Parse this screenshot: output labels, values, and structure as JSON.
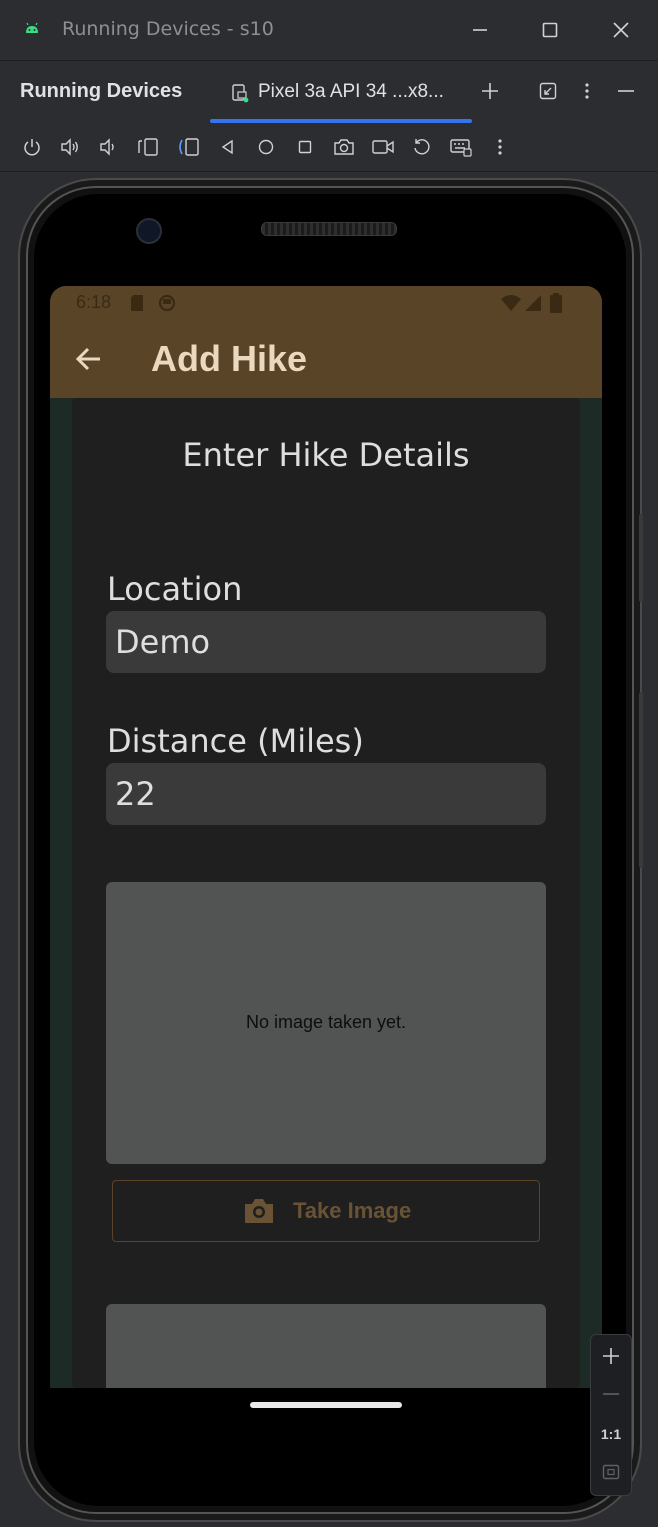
{
  "window": {
    "title": "Running Devices - s10"
  },
  "tool_window": {
    "title": "Running Devices",
    "device_tab_label": "Pixel 3a API 34 ...x8..."
  },
  "emulator_toolbar": {
    "icons": [
      "power-icon",
      "volume-up-icon",
      "volume-down-icon",
      "rotate-left-icon",
      "rotate-right-icon",
      "back-icon",
      "home-icon",
      "overview-icon",
      "screenshot-icon",
      "screen-record-icon",
      "reset-icon",
      "keyboard-icon",
      "more-icon"
    ]
  },
  "status_bar": {
    "time": "6:18"
  },
  "app": {
    "title": "Add Hike",
    "card_title": "Enter Hike Details",
    "location_label": "Location",
    "location_value": "Demo",
    "distance_label": "Distance (Miles)",
    "distance_value": "22",
    "image_placeholder": "No image taken yet.",
    "take_image_label": "Take Image"
  },
  "zoom_controls": {
    "actual_size_label": "1:1"
  },
  "colors": {
    "app_bar": "#5a4428",
    "background": "#1c2b26",
    "card": "#1f1f1f",
    "accent_tab": "#3574f0"
  }
}
